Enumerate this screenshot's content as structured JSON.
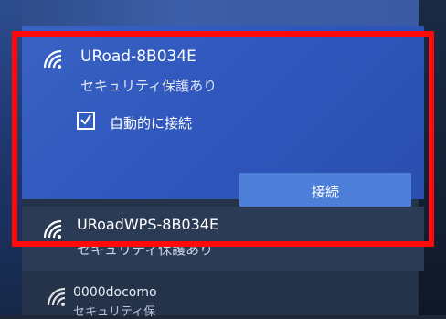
{
  "networks": [
    {
      "ssid": "URoad-8B034E",
      "security": "セキュリティ保護あり",
      "auto_connect_label": "自動的に接続",
      "auto_connect_checked": true,
      "connect_label": "接続",
      "icon": "wifi-icon",
      "selected": true
    },
    {
      "ssid": "URoadWPS-8B034E",
      "security": "セキュリティ保護あり",
      "icon": "wifi-icon"
    },
    {
      "ssid": "0000docomo",
      "security": "セキュリティ保",
      "icon": "wifi-icon"
    }
  ],
  "colors": {
    "selected_bg": "#2f57bd",
    "connect_button": "#4d7fd9",
    "highlight_border": "#ff0a0a"
  }
}
